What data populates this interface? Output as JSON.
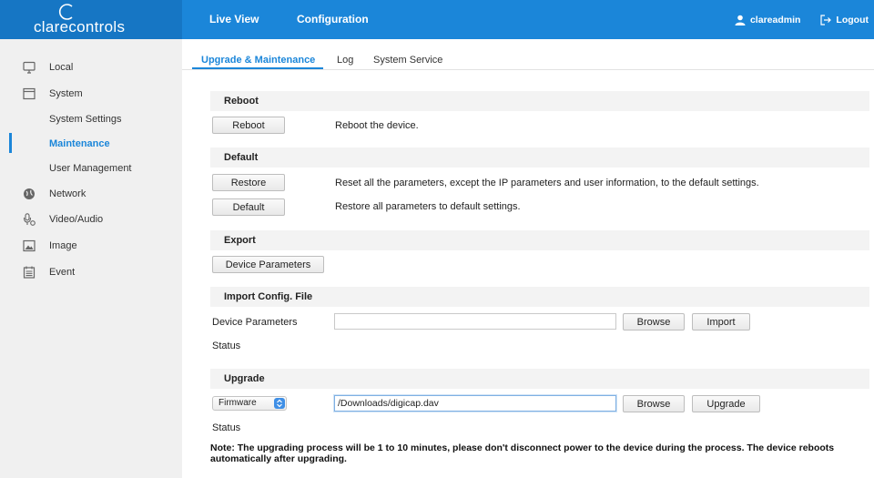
{
  "header": {
    "logo_text": "clarecontrols",
    "nav": [
      "Live View",
      "Configuration"
    ],
    "user": "clareadmin",
    "logout": "Logout"
  },
  "sidebar": {
    "items": [
      {
        "label": "Local",
        "icon": "monitor-icon"
      },
      {
        "label": "System",
        "icon": "window-icon"
      },
      {
        "label": "Network",
        "icon": "globe-icon"
      },
      {
        "label": "Video/Audio",
        "icon": "microphone-camera-icon"
      },
      {
        "label": "Image",
        "icon": "image-icon"
      },
      {
        "label": "Event",
        "icon": "calendar-icon"
      }
    ],
    "system_subitems": [
      "System Settings",
      "Maintenance",
      "User Management"
    ],
    "active_subitem": "Maintenance"
  },
  "tabs": [
    "Upgrade & Maintenance",
    "Log",
    "System Service"
  ],
  "active_tab": "Upgrade & Maintenance",
  "sections": {
    "reboot": {
      "title": "Reboot",
      "button": "Reboot",
      "desc": "Reboot the device."
    },
    "default": {
      "title": "Default",
      "restore_button": "Restore",
      "restore_desc": "Reset all the parameters, except the IP parameters and user information, to the default settings.",
      "default_button": "Default",
      "default_desc": "Restore all parameters to default settings."
    },
    "export": {
      "title": "Export",
      "button": "Device Parameters"
    },
    "import": {
      "title": "Import Config. File",
      "label": "Device Parameters",
      "file_value": "",
      "browse": "Browse",
      "import": "Import",
      "status_label": "Status"
    },
    "upgrade": {
      "title": "Upgrade",
      "select_value": "Firmware",
      "file_value": "/Downloads/digicap.dav",
      "browse": "Browse",
      "upgrade": "Upgrade",
      "status_label": "Status"
    }
  },
  "note": "Note: The upgrading process will be 1 to 10 minutes, please don't disconnect power to the device during the process. The device reboots automatically after upgrading.",
  "colors": {
    "accent": "#1b86d9",
    "header": "#1b86d9",
    "logo_bg": "#1676c4",
    "sidebar_bg": "#f0f0f0",
    "section_bg": "#f3f3f3"
  }
}
